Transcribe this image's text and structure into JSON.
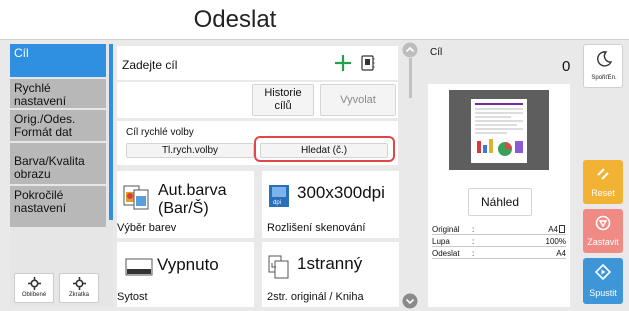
{
  "header": {
    "title": "Odeslat"
  },
  "nav": {
    "items": [
      {
        "label": "Cíl"
      },
      {
        "label": "Rychlé nastavení"
      },
      {
        "label": "Orig./Odes. Formát dat"
      },
      {
        "label": "Barva/Kvalita obrazu"
      },
      {
        "label": "Pokročilé nastavení"
      }
    ],
    "favorites_label": "Oblíbené",
    "shortcut_label": "Zkratka"
  },
  "destination": {
    "input_label": "Zadejte cíl",
    "history_label": "Historie cílů",
    "recall_label": "Vyvolat",
    "quick_title": "Cíl rychlé volby",
    "quick_button": "Tl.rych.volby",
    "search_button": "Hledat (č.)"
  },
  "functions": [
    {
      "value": "Aut.barva (Bar/Š)",
      "caption": "Výběr barev",
      "icon": "color-mode-icon"
    },
    {
      "value": "300x300dpi",
      "caption": "Rozlišení skenování",
      "icon": "dpi-icon"
    },
    {
      "value": "Vypnuto",
      "caption": "Sytost",
      "icon": "density-icon"
    },
    {
      "value": "1stranný",
      "caption": "2str. originál / Kniha",
      "icon": "duplex-icon"
    }
  ],
  "preview": {
    "dest_label": "Cíl",
    "dest_count": "0",
    "preview_button": "Náhled",
    "info": [
      {
        "label": "Originál",
        "sep": ":",
        "value": "A4"
      },
      {
        "label": "Lupa",
        "sep": ":",
        "value": "100%"
      },
      {
        "label": "Odeslat",
        "sep": ":",
        "value": "A4"
      }
    ]
  },
  "side": {
    "sleep_label": "SpořiťEn.",
    "reset_label": "Reset",
    "stop_label": "Zastavit",
    "start_label": "Spustit"
  },
  "colors": {
    "accent": "#2f8fe0",
    "reset": "#f2b234",
    "stop": "#f08a85",
    "start": "#3d96d8",
    "highlight": "#e04848",
    "plus": "#22a04a"
  }
}
